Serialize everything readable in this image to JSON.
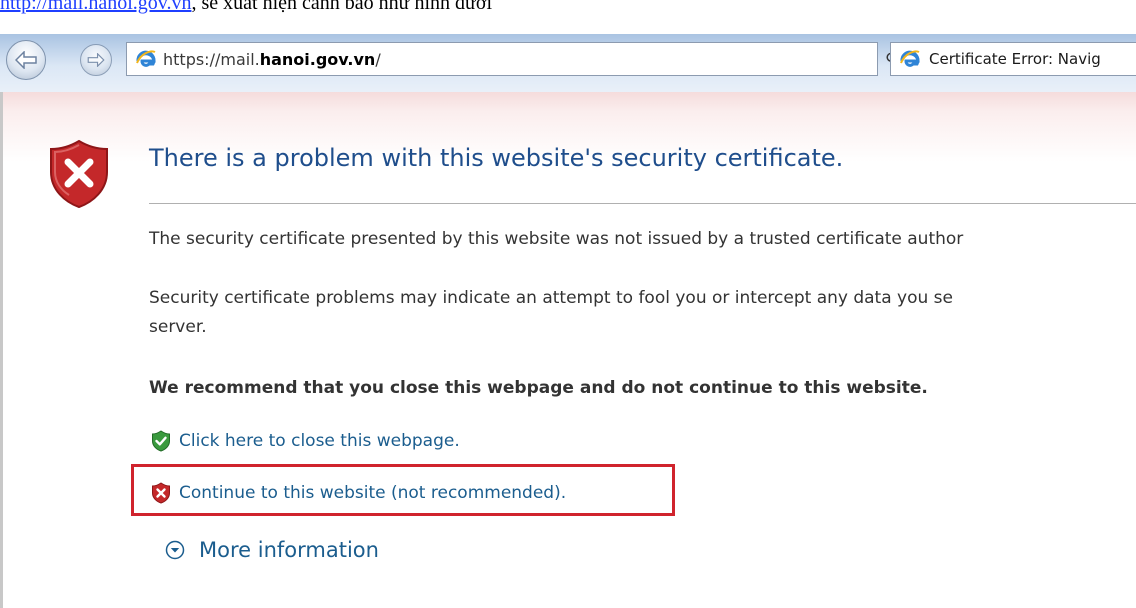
{
  "document": {
    "snippet_link": "http://mail.hanoi.gov.vn",
    "snippet_text": ", sẽ xuất hiện cảnh báo như hình dưới"
  },
  "browser": {
    "url_prefix": "https://mail.",
    "url_domain": "hanoi.gov.vn",
    "url_suffix": "/",
    "search_glyph": "⚲",
    "dropdown_glyph": "▾",
    "refresh_glyph": "↻",
    "stop_glyph": "✕",
    "tab_title": "Certificate Error: Navig"
  },
  "page": {
    "title": "There is a problem with this website's security certificate.",
    "para1": "The security certificate presented by this website was not issued by a trusted certificate author",
    "para2_line1": "Security certificate problems may indicate an attempt to fool you or intercept any data you se",
    "para2_line2": "server.",
    "recommendation": "We recommend that you close this webpage and do not continue to this website.",
    "close_link": "Click here to close this webpage.",
    "continue_link": "Continue to this website (not recommended).",
    "more_info": "More information"
  },
  "icons": {
    "warning": "shield-x-icon",
    "close_link": "green-shield-check-icon",
    "continue_link": "red-shield-x-icon",
    "more_info": "chevron-down-circle-icon"
  },
  "colors": {
    "title": "#1f4e8c",
    "link": "#1b5d8e",
    "highlight": "#d0232d",
    "shield_red": "#c4282a",
    "shield_green": "#3a9a3e"
  }
}
